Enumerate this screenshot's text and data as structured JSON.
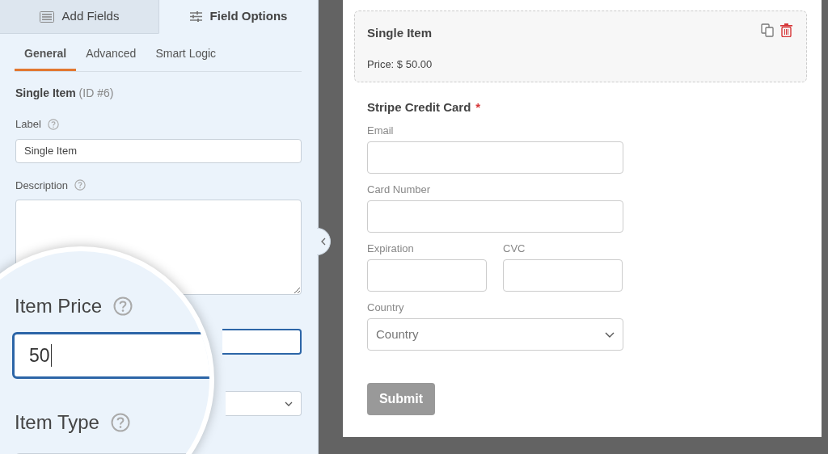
{
  "panel_tabs": [
    {
      "label": "Add Fields",
      "selected": false
    },
    {
      "label": "Field Options",
      "selected": true
    }
  ],
  "sub_tabs": [
    {
      "label": "General",
      "selected": true
    },
    {
      "label": "Advanced",
      "selected": false
    },
    {
      "label": "Smart Logic",
      "selected": false
    }
  ],
  "field_heading": {
    "name": "Single Item",
    "id": "(ID #6)"
  },
  "options": [
    {
      "kind": "input",
      "label": "Label",
      "value": "Single Item"
    },
    {
      "kind": "textarea",
      "label": "Description"
    }
  ],
  "magnifier": {
    "price_label": "Item Price",
    "price_value": "50",
    "type_label": "Item Type"
  },
  "preview": {
    "single_item": {
      "title": "Single Item",
      "price": "Price: $ 50.00"
    },
    "card": {
      "title": "Stripe Credit Card",
      "required_mark": "*",
      "fields": [
        {
          "label": "Email",
          "kind": "full"
        },
        {
          "label": "Card Number",
          "kind": "full"
        },
        {
          "label": "Expiration",
          "kind": "half"
        },
        {
          "label": "CVC",
          "kind": "half"
        },
        {
          "label": "Country",
          "kind": "select",
          "placeholder": "Country"
        }
      ]
    },
    "submit": "Submit"
  }
}
